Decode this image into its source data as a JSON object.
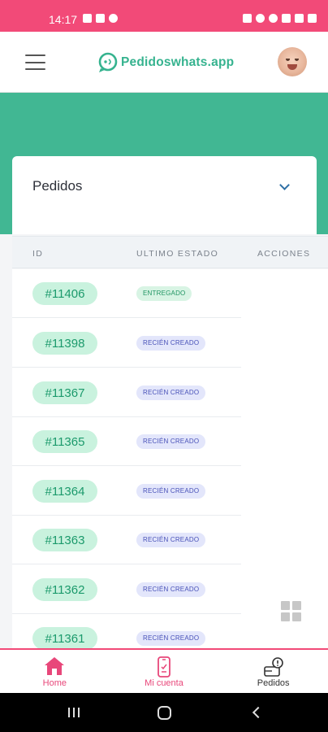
{
  "status_bar": {
    "time": "14:17"
  },
  "header": {
    "logo_text": "Pedidoswhats.app"
  },
  "colors": {
    "brand_pink": "#f24a78",
    "brand_green": "#41b793",
    "pill_green": "#c9f2de",
    "badge_blue": "#e3e6fb"
  },
  "card": {
    "title": "Pedidos"
  },
  "table": {
    "headers": {
      "id": "ID",
      "status": "ULTIMO ESTADO",
      "actions": "ACCIONES"
    },
    "rows": [
      {
        "id": "#11406",
        "status": "ENTREGADO"
      },
      {
        "id": "#11398",
        "status": "RECIÉN CREADO"
      },
      {
        "id": "#11367",
        "status": "RECIÉN CREADO"
      },
      {
        "id": "#11365",
        "status": "RECIÉN CREADO"
      },
      {
        "id": "#11364",
        "status": "RECIÉN CREADO"
      },
      {
        "id": "#11363",
        "status": "RECIÉN CREADO"
      },
      {
        "id": "#11362",
        "status": "RECIÉN CREADO"
      },
      {
        "id": "#11361",
        "status": "RECIÉN CREADO"
      }
    ]
  },
  "bottom_nav": {
    "items": [
      {
        "label": "Home",
        "icon": "house-icon"
      },
      {
        "label": "Mi cuenta",
        "icon": "phone-icon"
      },
      {
        "label": "Pedidos",
        "icon": "orders-icon"
      }
    ]
  }
}
